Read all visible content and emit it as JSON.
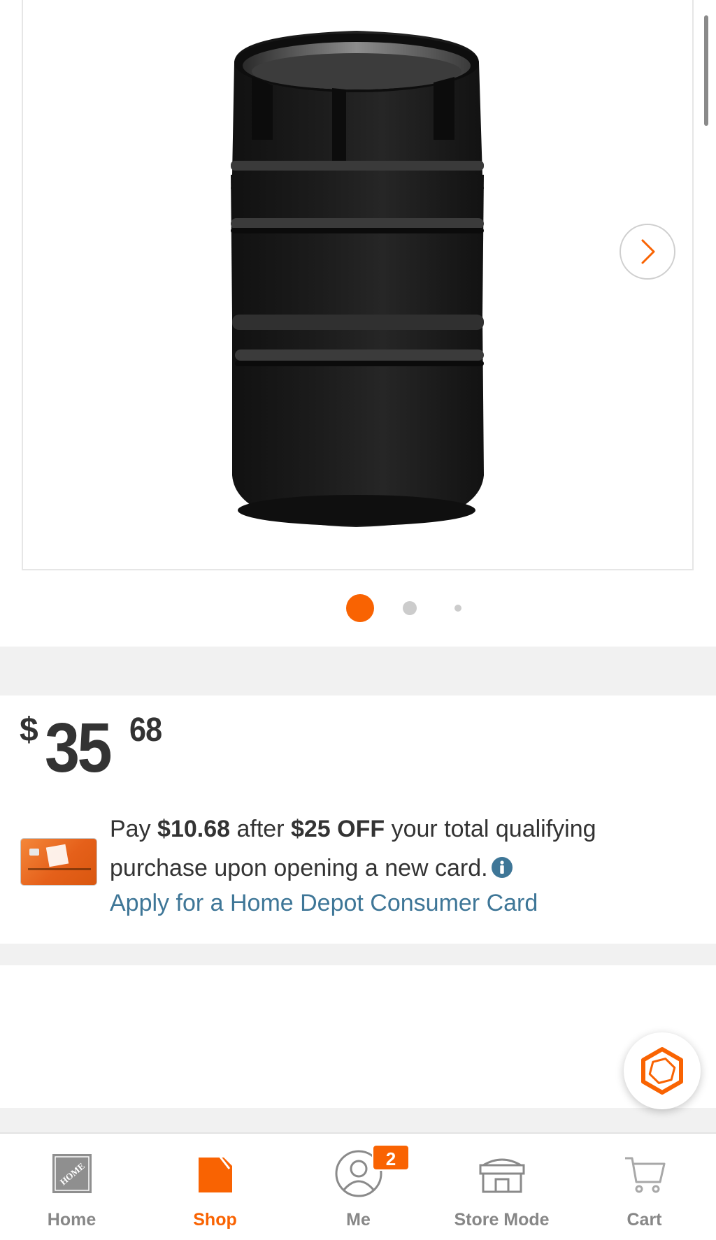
{
  "gallery": {
    "image_alt": "Black stove pipe adapter",
    "pagination": {
      "total": 3,
      "active_index": 0
    }
  },
  "price": {
    "currency": "$",
    "dollars": "35",
    "cents": "68"
  },
  "promo": {
    "text_1": "Pay ",
    "amount_after": "$10.68",
    "text_2": " after ",
    "discount": "$25 OFF",
    "text_3": " your total qualifying purchase upon opening a new card.",
    "apply_link": "Apply for a Home Depot Consumer Card"
  },
  "tabbar": {
    "items": [
      {
        "label": "Home"
      },
      {
        "label": "Shop"
      },
      {
        "label": "Me"
      },
      {
        "label": "Store Mode"
      },
      {
        "label": "Cart"
      }
    ],
    "active": "Shop",
    "me_badge": "2"
  },
  "colors": {
    "brand_orange": "#f96302",
    "link_blue": "#3e7697",
    "text_dark": "#333333",
    "tab_gray": "#878787"
  },
  "icons": {
    "next": "chevron-right-icon",
    "info": "info-icon",
    "chat": "hexagon-chat-icon",
    "home": "home-depot-logo-icon",
    "shop": "shop-tag-icon",
    "me": "user-icon",
    "store": "store-icon",
    "cart": "cart-icon"
  }
}
